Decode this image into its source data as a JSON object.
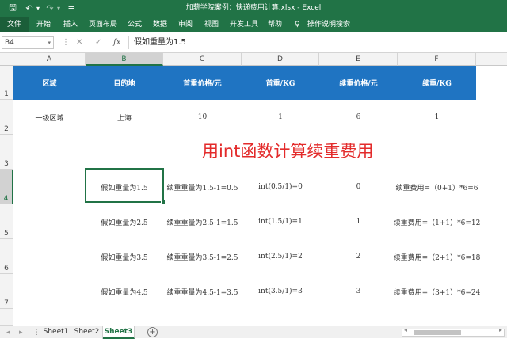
{
  "window": {
    "title": "加薪学院案例：快递费用计算.xlsx  -  Excel",
    "save_icon": "save-icon",
    "undo_icon": "undo-icon",
    "redo_icon": "redo-icon",
    "customize_icon": "customize-qat-icon",
    "qa_save": "🖫",
    "qa_undo": "↶",
    "qa_undo_dd": "▾",
    "qa_redo": "↷",
    "qa_redo_dd": "▾",
    "qa_more": "≡"
  },
  "ribbon": {
    "tabs": [
      "文件",
      "开始",
      "插入",
      "页面布局",
      "公式",
      "数据",
      "审阅",
      "视图",
      "开发工具",
      "帮助"
    ],
    "tell_me_icon": "lightbulb-icon",
    "tell_me_glyph": "♀",
    "tell_me": "操作说明搜索"
  },
  "formula_bar": {
    "name_box": "B4",
    "dropdown": "▾",
    "sep": "⋮",
    "cancel": "✕",
    "enter": "✓",
    "fx": "fx",
    "content": "假如重量为1.5"
  },
  "columns": [
    "A",
    "B",
    "C",
    "D",
    "E",
    "F"
  ],
  "rows": [
    "1",
    "2",
    "3",
    "4",
    "5",
    "6",
    "7"
  ],
  "header_row": [
    "区域",
    "目的地",
    "首重价格/元",
    "首重/KG",
    "续重价格/元",
    "续重/KG"
  ],
  "row2": [
    "一级区域",
    "上海",
    "10",
    "1",
    "6",
    "1"
  ],
  "title": "用int函数计算续重费用",
  "examples": [
    [
      "假如重量为1.5",
      "续重重量为1.5-1=0.5",
      "int(0.5/1)=0",
      "0",
      "续重费用=（0+1）*6=6"
    ],
    [
      "假如重量为2.5",
      "续重重量为2.5-1=1.5",
      "int(1.5/1)=1",
      "1",
      "续重费用=（1+1）*6=12"
    ],
    [
      "假如重量为3.5",
      "续重重量为3.5-1=2.5",
      "int(2.5/1)=2",
      "2",
      "续重费用=（2+1）*6=18"
    ],
    [
      "假如重量为4.5",
      "续重重量为4.5-1=3.5",
      "int(3.5/1)=3",
      "3",
      "续重费用=（3+1）*6=24"
    ]
  ],
  "sheets": [
    "Sheet1",
    "Sheet2",
    "Sheet3"
  ],
  "active_sheet": "Sheet3",
  "status": {
    "nav_left": "◂",
    "nav_right": "▸",
    "sep": "⋮",
    "add": "+",
    "scroll_left": "◂",
    "scroll_right": "▸"
  },
  "colors": {
    "excel_green": "#217346",
    "header_blue": "#1f74c2",
    "title_red": "#e32b2b"
  }
}
